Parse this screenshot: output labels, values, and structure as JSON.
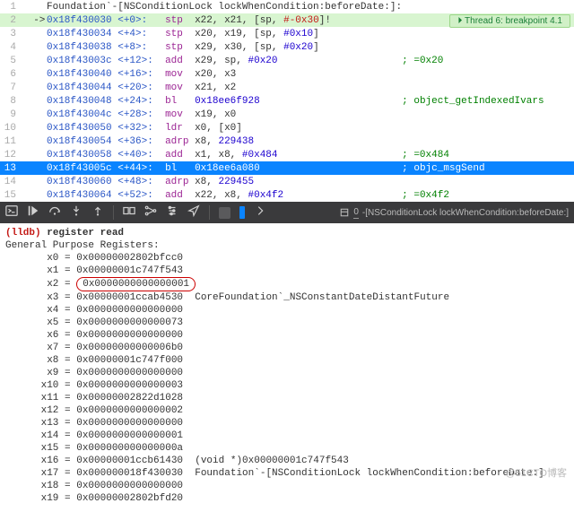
{
  "header_symbol": "Foundation`-[NSConditionLock lockWhenCondition:beforeDate:]:",
  "breakpoint_badge": {
    "icon": "⏵",
    "text": "Thread 6: breakpoint 4.1"
  },
  "asm": [
    {
      "n": "1",
      "arrow": "",
      "addr": "",
      "off": "",
      "mn": "",
      "args": "",
      "cmt": "",
      "header": true
    },
    {
      "n": "2",
      "arrow": "->",
      "addr": "0x18f430030",
      "off": "<+0>:",
      "mn": "stp",
      "args": "x22, x21, [sp, ",
      "lit": "#-0x30",
      "tail": "]!",
      "hl": "green"
    },
    {
      "n": "3",
      "arrow": "",
      "addr": "0x18f430034",
      "off": "<+4>:",
      "mn": "stp",
      "args": "x20, x19, [sp, ",
      "lit2": "#0x10",
      "tail": "]"
    },
    {
      "n": "4",
      "arrow": "",
      "addr": "0x18f430038",
      "off": "<+8>:",
      "mn": "stp",
      "args": "x29, x30, [sp, ",
      "lit2": "#0x20",
      "tail": "]"
    },
    {
      "n": "5",
      "arrow": "",
      "addr": "0x18f43003c",
      "off": "<+12>:",
      "mn": "add",
      "args": "x29, sp, ",
      "lit2": "#0x20",
      "cmt": "; =0x20"
    },
    {
      "n": "6",
      "arrow": "",
      "addr": "0x18f430040",
      "off": "<+16>:",
      "mn": "mov",
      "args": "x20, x3"
    },
    {
      "n": "7",
      "arrow": "",
      "addr": "0x18f430044",
      "off": "<+20>:",
      "mn": "mov",
      "args": "x21, x2"
    },
    {
      "n": "8",
      "arrow": "",
      "addr": "0x18f430048",
      "off": "<+24>:",
      "mn": "bl",
      "args": "",
      "callnum": "0x18ee6f928",
      "cmt": "; object_getIndexedIvars"
    },
    {
      "n": "9",
      "arrow": "",
      "addr": "0x18f43004c",
      "off": "<+28>:",
      "mn": "mov",
      "args": "x19, x0"
    },
    {
      "n": "10",
      "arrow": "",
      "addr": "0x18f430050",
      "off": "<+32>:",
      "mn": "ldr",
      "args": "x0, [x0]"
    },
    {
      "n": "11",
      "arrow": "",
      "addr": "0x18f430054",
      "off": "<+36>:",
      "mn": "adrp",
      "args": "x8, ",
      "callnum": "229438"
    },
    {
      "n": "12",
      "arrow": "",
      "addr": "0x18f430058",
      "off": "<+40>:",
      "mn": "add",
      "args": "x1, x8, ",
      "lit2": "#0x484",
      "cmt": "; =0x484"
    },
    {
      "n": "13",
      "arrow": "",
      "addr": "0x18f43005c",
      "off": "<+44>:",
      "mn": "bl",
      "args": "",
      "callnum": "0x18ee6a080",
      "cmt": "; objc_msgSend",
      "hl": "blue"
    },
    {
      "n": "14",
      "arrow": "",
      "addr": "0x18f430060",
      "off": "<+48>:",
      "mn": "adrp",
      "args": "x8, ",
      "callnum": "229455"
    },
    {
      "n": "15",
      "arrow": "",
      "addr": "0x18f430064",
      "off": "<+52>:",
      "mn": "add",
      "args": "x22, x8, ",
      "lit2": "#0x4f2",
      "cmt": "; =0x4f2"
    }
  ],
  "jump_target": "-[NSConditionLock lockWhenCondition:beforeDate:]",
  "jump_prefix": "0",
  "console": {
    "prompt": "(lldb)",
    "command": "register read",
    "title": "General Purpose Registers:",
    "regs": [
      {
        "r": "x0",
        "v": "0x00000002802bfcc0",
        "note": ""
      },
      {
        "r": "x1",
        "v": "0x00000001c747f543",
        "note": ""
      },
      {
        "r": "x2",
        "v": "0x0000000000000001",
        "note": "",
        "circle": true
      },
      {
        "r": "x3",
        "v": "0x00000001ccab4530",
        "note": "CoreFoundation`_NSConstantDateDistantFuture"
      },
      {
        "r": "x4",
        "v": "0x0000000000000000",
        "note": ""
      },
      {
        "r": "x5",
        "v": "0x0000000000000073",
        "note": ""
      },
      {
        "r": "x6",
        "v": "0x0000000000000000",
        "note": ""
      },
      {
        "r": "x7",
        "v": "0x00000000000006b0",
        "note": ""
      },
      {
        "r": "x8",
        "v": "0x00000001c747f000",
        "note": ""
      },
      {
        "r": "x9",
        "v": "0x0000000000000000",
        "note": ""
      },
      {
        "r": "x10",
        "v": "0x0000000000000003",
        "note": ""
      },
      {
        "r": "x11",
        "v": "0x00000002822d1028",
        "note": ""
      },
      {
        "r": "x12",
        "v": "0x0000000000000002",
        "note": ""
      },
      {
        "r": "x13",
        "v": "0x0000000000000000",
        "note": ""
      },
      {
        "r": "x14",
        "v": "0x0000000000000001",
        "note": ""
      },
      {
        "r": "x15",
        "v": "0x000000000000000a",
        "note": ""
      },
      {
        "r": "x16",
        "v": "0x00000001ccb61430",
        "note": "(void *)0x00000001c747f543"
      },
      {
        "r": "x17",
        "v": "0x000000018f430030",
        "note": "Foundation`-[NSConditionLock lockWhenCondition:beforeDate:]"
      },
      {
        "r": "x18",
        "v": "0x0000000000000000",
        "note": ""
      },
      {
        "r": "x19",
        "v": "0x00000002802bfd20",
        "note": ""
      }
    ]
  },
  "watermark": "@51CTO博客"
}
